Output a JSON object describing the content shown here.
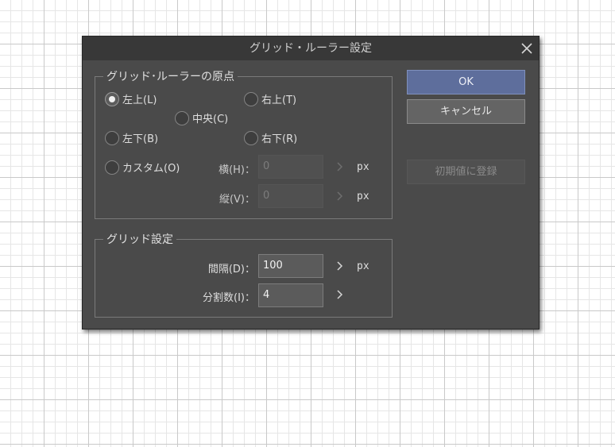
{
  "dialog": {
    "title": "グリッド・ルーラー設定",
    "close_icon": "close-icon"
  },
  "origin": {
    "legend": "グリッド･ルーラーの原点",
    "options": [
      {
        "label": "左上(L)",
        "checked": true
      },
      {
        "label": "右上(T)",
        "checked": false
      },
      {
        "label": "中央(C)",
        "checked": false
      },
      {
        "label": "左下(B)",
        "checked": false
      },
      {
        "label": "右下(R)",
        "checked": false
      },
      {
        "label": "カスタム(O)",
        "checked": false
      }
    ],
    "horizontal": {
      "label": "横(H)：",
      "value": "0",
      "unit": "px"
    },
    "vertical": {
      "label": "縦(V)：",
      "value": "0",
      "unit": "px"
    }
  },
  "grid": {
    "legend": "グリッド設定",
    "interval": {
      "label": "間隔(D)：",
      "value": "100",
      "unit": "px"
    },
    "divisions": {
      "label": "分割数(I)：",
      "value": "4"
    }
  },
  "buttons": {
    "ok": "OK",
    "cancel": "キャンセル",
    "register_default": "初期値に登録"
  },
  "colors": {
    "dialog_bg": "#4a4a4a",
    "titlebar_bg": "#383838",
    "primary_button": "#5e6e9c",
    "canvas_grid": "#c9c9c9"
  }
}
